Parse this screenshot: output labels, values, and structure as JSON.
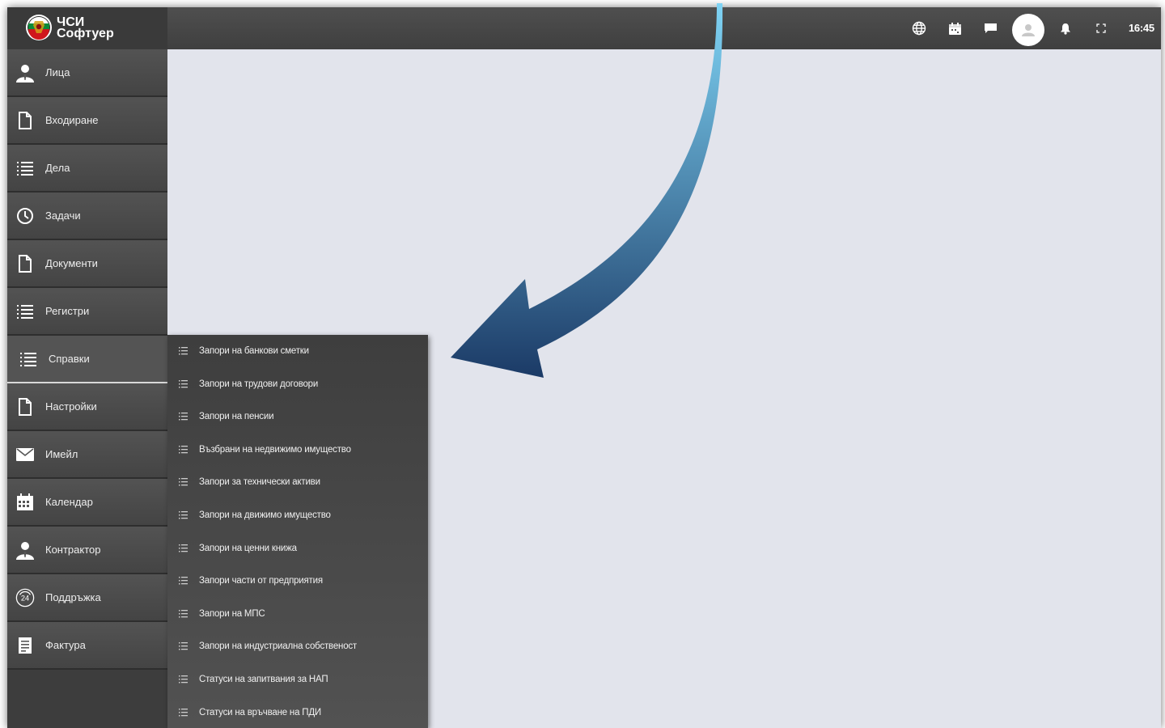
{
  "header": {
    "logo_line1": "ЧСИ",
    "logo_line2": "Софтуер",
    "time": "16:45",
    "icons": [
      "globe-icon",
      "calendar-icon",
      "message-icon",
      "user-avatar-icon",
      "bell-icon",
      "fullscreen-icon"
    ]
  },
  "sidebar": {
    "items": [
      {
        "label": "Лица",
        "icon": "person-icon"
      },
      {
        "label": "Входиране",
        "icon": "document-icon"
      },
      {
        "label": "Дела",
        "icon": "list-icon"
      },
      {
        "label": "Задачи",
        "icon": "clock-icon"
      },
      {
        "label": "Документи",
        "icon": "document-icon"
      },
      {
        "label": "Регистри",
        "icon": "list-icon"
      },
      {
        "label": "Справки",
        "icon": "list-icon",
        "active": true
      },
      {
        "label": "Настройки",
        "icon": "document-icon"
      },
      {
        "label": "Имейл",
        "icon": "envelope-icon"
      },
      {
        "label": "Календар",
        "icon": "calendar-icon"
      },
      {
        "label": "Контрактор",
        "icon": "person-icon"
      },
      {
        "label": "Поддръжка",
        "icon": "support-24-icon"
      },
      {
        "label": "Фактура",
        "icon": "invoice-icon"
      }
    ]
  },
  "submenu": {
    "items": [
      {
        "label": "Запори на банкови сметки"
      },
      {
        "label": "Запори на трудови договори"
      },
      {
        "label": "Запори на пенсии"
      },
      {
        "label": "Възбрани на недвижимо имущество"
      },
      {
        "label": "Запори за технически активи"
      },
      {
        "label": "Запори на движимо имущество"
      },
      {
        "label": "Запори на ценни книжа"
      },
      {
        "label": "Запори части от предприятия"
      },
      {
        "label": "Запори на МПС"
      },
      {
        "label": "Запори на индустриална собственост"
      },
      {
        "label": "Статуси на запитвания за НАП"
      },
      {
        "label": "Статуси на връчване на ПДИ"
      }
    ]
  },
  "annotation": {
    "icon": "curved-arrow-icon",
    "gradient_start": "#7fd4f5",
    "gradient_end": "#1b3a66"
  },
  "colors": {
    "topbar": "#474747",
    "sidebar": "#4a4a4a",
    "content_background": "#e2e4ec",
    "text": "#ffffff"
  }
}
